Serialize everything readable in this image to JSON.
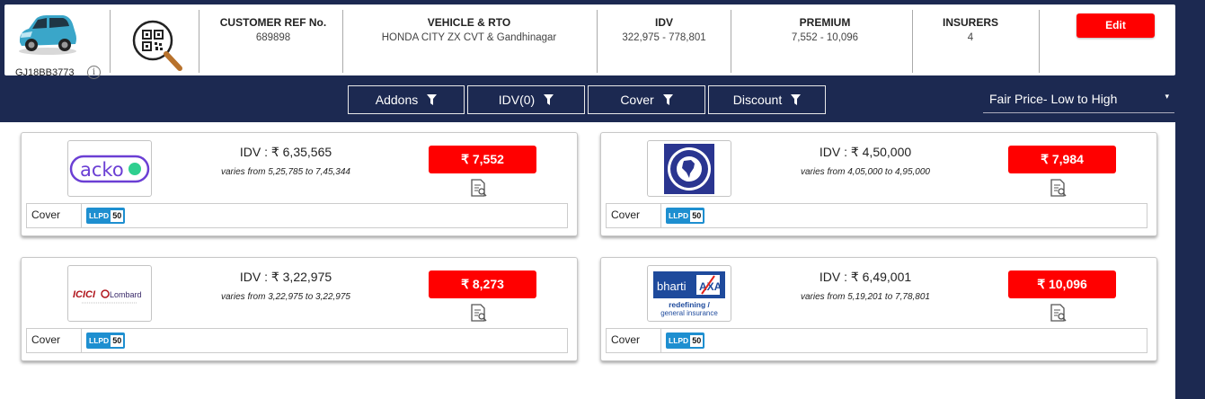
{
  "vehicle": {
    "reg_no": "GJ18BB3773",
    "info_icon": "i"
  },
  "summary": {
    "customer_ref": {
      "label": "CUSTOMER REF No.",
      "value": "689898"
    },
    "vehicle_rto": {
      "label": "VEHICLE & RTO",
      "value": "HONDA CITY ZX CVT & Gandhinagar"
    },
    "idv": {
      "label": "IDV",
      "value": "322,975 - 778,801"
    },
    "premium": {
      "label": "PREMIUM",
      "value": "7,552 - 10,096"
    },
    "insurers": {
      "label": "INSURERS",
      "value": "4"
    },
    "edit_label": "Edit"
  },
  "filters": [
    {
      "label": "Addons",
      "icon": "filter-icon"
    },
    {
      "label": "IDV(0)",
      "icon": "filter-icon"
    },
    {
      "label": "Cover",
      "icon": "filter-icon"
    },
    {
      "label": "Discount",
      "icon": "filter-icon"
    }
  ],
  "sort": {
    "selected": "Fair Price- Low to High",
    "caret": "▾"
  },
  "quotes": [
    {
      "insurer_logo": "acko-logo",
      "logo_text": "acko",
      "idv": "IDV : ₹ 6,35,565",
      "range": "varies from 5,25,785 to 7,45,344",
      "price": "₹ 7,552",
      "cover_label": "Cover",
      "addon_label": "LLPD",
      "addon_amount": "50"
    },
    {
      "insurer_logo": "new-india-assurance-logo",
      "logo_text": "",
      "idv": "IDV : ₹ 4,50,000",
      "range": "varies from 4,05,000 to 4,95,000",
      "price": "₹ 7,984",
      "cover_label": "Cover",
      "addon_label": "LLPD",
      "addon_amount": "50"
    },
    {
      "insurer_logo": "icici-lombard-logo",
      "logo_text": "ICICI Lombard",
      "idv": "IDV : ₹ 3,22,975",
      "range": "varies from 3,22,975 to 3,22,975",
      "price": "₹ 8,273",
      "cover_label": "Cover",
      "addon_label": "LLPD",
      "addon_amount": "50"
    },
    {
      "insurer_logo": "bharti-axa-logo",
      "logo_text": "bharti AXA",
      "logo_tagline_1": "redefining /",
      "logo_tagline_2": "general insurance",
      "idv": "IDV : ₹ 6,49,001",
      "range": "varies from 5,19,201 to 7,78,801",
      "price": "₹ 10,096",
      "cover_label": "Cover",
      "addon_label": "LLPD",
      "addon_amount": "50"
    }
  ],
  "colors": {
    "navy": "#1c2951",
    "accent_red": "#ff0000",
    "addon_blue": "#1e8fd0"
  }
}
